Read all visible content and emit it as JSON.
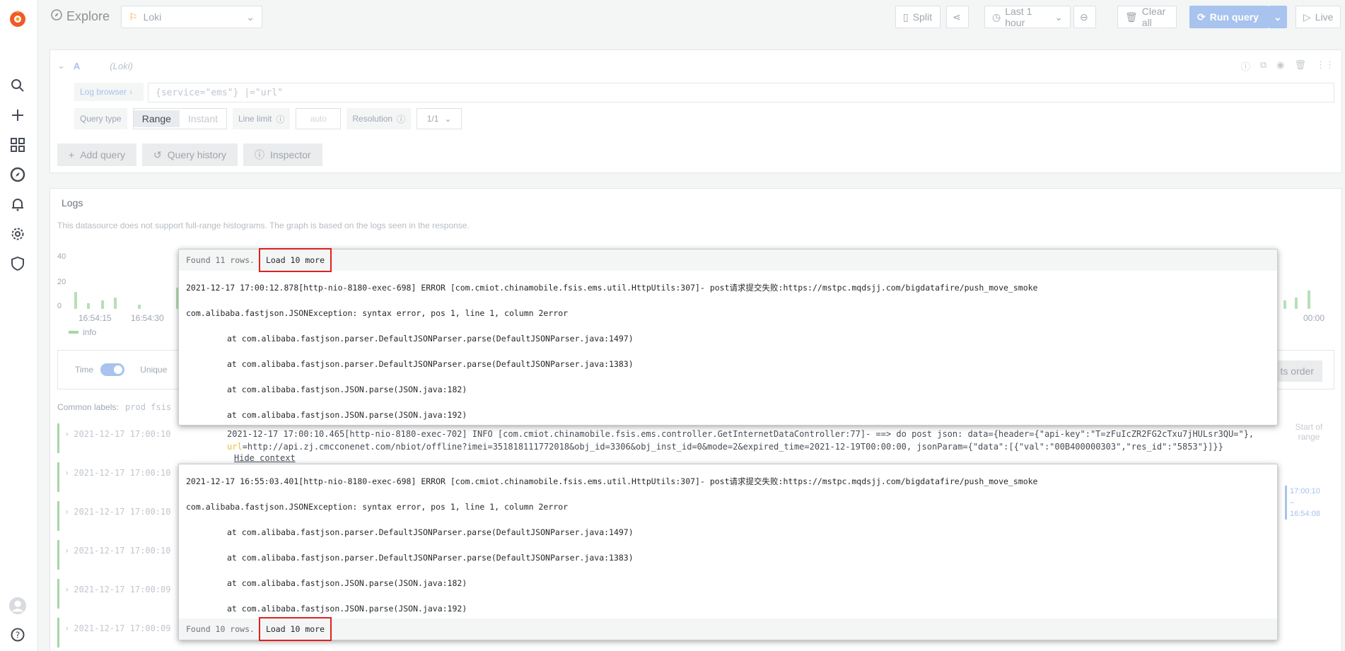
{
  "sidebar": {
    "items": [
      "search-icon",
      "plus-icon",
      "dashboards-icon",
      "explore-icon",
      "alerting-icon",
      "configuration-icon",
      "shield-icon"
    ],
    "bottom": [
      "avatar",
      "help-icon"
    ]
  },
  "toolbar": {
    "title": "Explore",
    "datasource": "Loki",
    "split_label": "Split",
    "time_range": "Last 1 hour",
    "clear_label": "Clear all",
    "run_label": "Run query",
    "live_label": "Live"
  },
  "query": {
    "ref_id": "A",
    "ds_hint": "(Loki)",
    "log_browser_label": "Log browser",
    "expression": "{service=\"ems\"} |=\"url\"",
    "query_type_label": "Query type",
    "range_label": "Range",
    "instant_label": "Instant",
    "line_limit_label": "Line limit",
    "line_limit_placeholder": "auto",
    "resolution_label": "Resolution",
    "resolution_value": "1/1",
    "add_query_label": "Add query",
    "history_label": "Query history",
    "inspector_label": "Inspector"
  },
  "logs": {
    "title": "Logs",
    "subtitle": "This datasource does not support full-range histograms. The graph is based on the logs seen in the response.",
    "y_ticks": [
      "40",
      "20",
      "0"
    ],
    "x_ticks": [
      "16:54:15",
      "16:54:30",
      "00:00"
    ],
    "legend": "info",
    "time_label": "Time",
    "unique_label": "Unique",
    "order_label": "ts order",
    "common_labels_label": "Common labels:",
    "common_labels_values": "prod fsis",
    "row_timestamps": [
      "2021-12-17 17:00:10",
      "2021-12-17 17:00:10",
      "2021-12-17 17:00:10",
      "2021-12-17 17:00:10",
      "2021-12-17 17:00:09",
      "2021-12-17 17:00:09"
    ],
    "main_line_a": "2021-12-17 17:00:10.465[http-nio-8180-exec-702] INFO  [com.cmiot.chinamobile.fsis.ems.controller.GetInternetDataController:77]- ==> do post json: data={header={\"api-key\":\"T=zFuIcZR2FG2cTxu7jHULsr3QU=\"}, ",
    "main_line_url": "url",
    "main_line_b": "=http://api.zj.cmcconenet.com/nbiot/offline?imei=351818111772018&obj_id=3306&obj_inst_id=0&mode=2&expired_time=2021-12-19T00:00:00, jsonParam={\"data\":[{\"val\":\"00B400000303\",\"res_id\":\"5853\"}]}}",
    "hide_context": "Hide context",
    "range_start": "Start of range",
    "range_time_top": "17:00:10",
    "range_dash": "–",
    "range_time_bottom": "16:54:08"
  },
  "ctx_top": {
    "found": "Found 11 rows.",
    "load_more": "Load 10 more",
    "lines": [
      "2021-12-17 17:00:12.878[http-nio-8180-exec-698] ERROR [com.cmiot.chinamobile.fsis.ems.util.HttpUtils:307]- post请求提交失败:https://mstpc.mqdsjj.com/bigdatafire/push_move_smoke",
      "com.alibaba.fastjson.JSONException: syntax error, pos 1, line 1, column 2error",
      "at com.alibaba.fastjson.parser.DefaultJSONParser.parse(DefaultJSONParser.java:1497)",
      "at com.alibaba.fastjson.parser.DefaultJSONParser.parse(DefaultJSONParser.java:1383)",
      "at com.alibaba.fastjson.JSON.parse(JSON.java:182)",
      "at com.alibaba.fastjson.JSON.parse(JSON.java:192)"
    ]
  },
  "ctx_bottom": {
    "found": "Found 10 rows.",
    "load_more": "Load 10 more",
    "lines": [
      "2021-12-17 16:55:03.401[http-nio-8180-exec-698] ERROR [com.cmiot.chinamobile.fsis.ems.util.HttpUtils:307]- post请求提交失败:https://mstpc.mqdsjj.com/bigdatafire/push_move_smoke",
      "com.alibaba.fastjson.JSONException: syntax error, pos 1, line 1, column 2error",
      "at com.alibaba.fastjson.parser.DefaultJSONParser.parse(DefaultJSONParser.java:1497)",
      "at com.alibaba.fastjson.parser.DefaultJSONParser.parse(DefaultJSONParser.java:1383)",
      "at com.alibaba.fastjson.JSON.parse(JSON.java:182)",
      "at com.alibaba.fastjson.JSON.parse(JSON.java:192)"
    ]
  },
  "colors": {
    "accent": "#a7c3ee",
    "log_info": "#a8d6a8",
    "highlight_box": "#e02020",
    "url_highlight": "#e7bd3a"
  }
}
